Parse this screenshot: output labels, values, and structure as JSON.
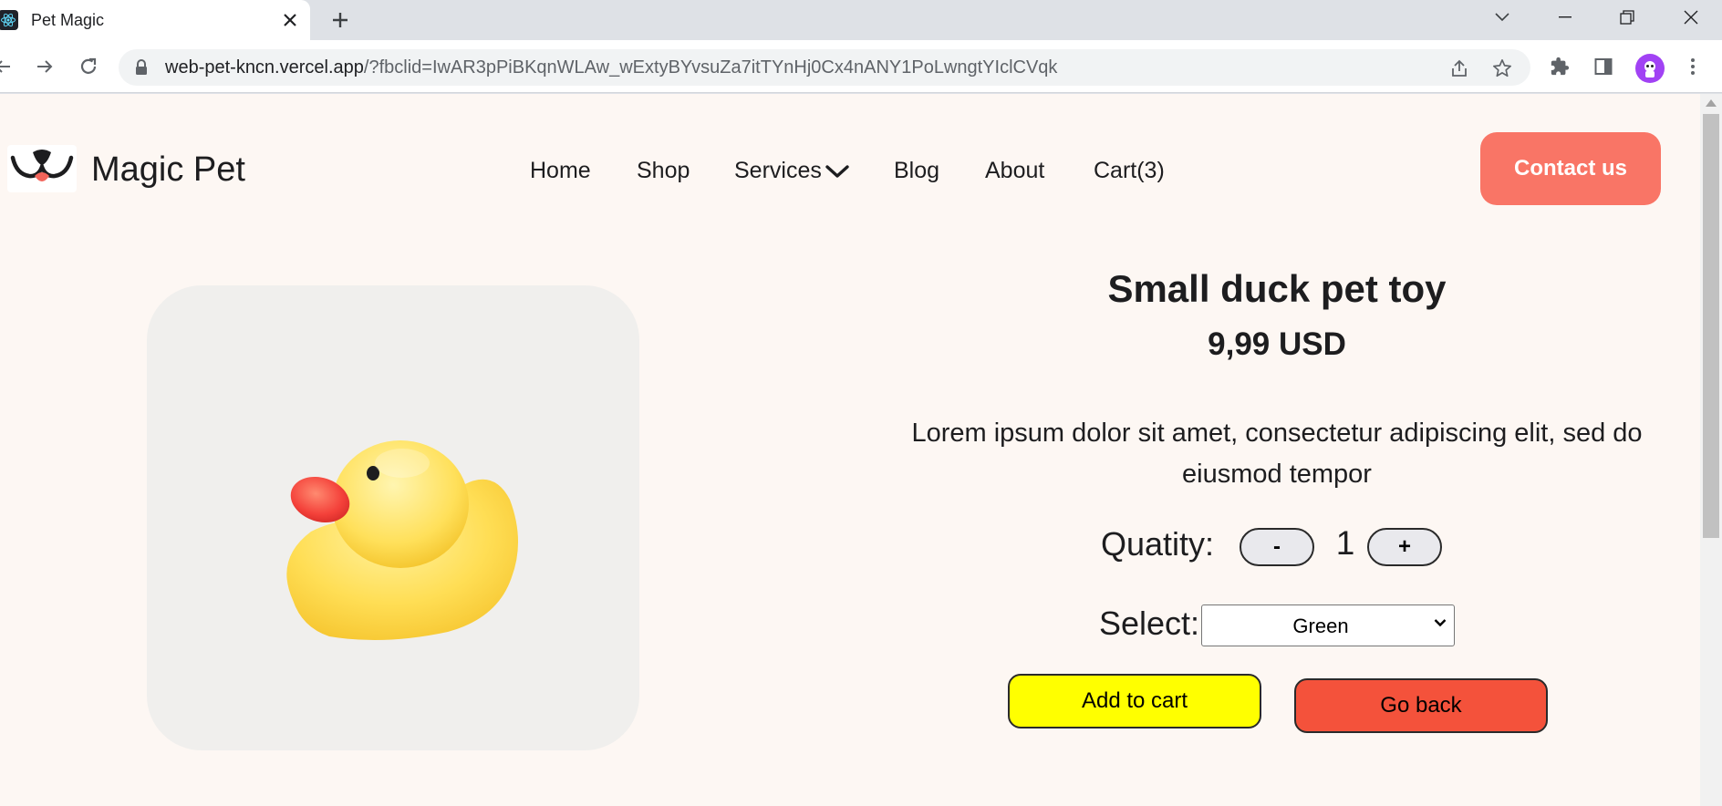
{
  "browser": {
    "tab_title": "Pet Magic",
    "url_domain": "web-pet-kncn.vercel.app",
    "url_path": "/?fbclid=IwAR3pPiBKqnWLAw_wExtyBYvsuZa7itTYnHj0Cx4nANY1PoLwngtYIclCVqk"
  },
  "site": {
    "brand": "Magic Pet",
    "nav": {
      "home": "Home",
      "shop": "Shop",
      "services": "Services",
      "blog": "Blog",
      "about": "About",
      "cart": "Cart(3)"
    },
    "contact_label": "Contact us"
  },
  "product": {
    "title": "Small duck pet toy",
    "price": "9,99 USD",
    "description": "Lorem ipsum dolor sit amet, consectetur adipiscing elit, sed do eiusmod tempor",
    "quantity_label": "Quatity:",
    "decrement_label": "-",
    "quantity": "1",
    "increment_label": "+",
    "select_label": "Select:",
    "select_value": "Green",
    "add_to_cart_label": "Add to cart",
    "go_back_label": "Go back"
  },
  "colors": {
    "page_background": "#fdf7f3",
    "contact_button": "#f97566",
    "add_to_cart_button": "#ffff00",
    "go_back_button": "#f4523b"
  }
}
